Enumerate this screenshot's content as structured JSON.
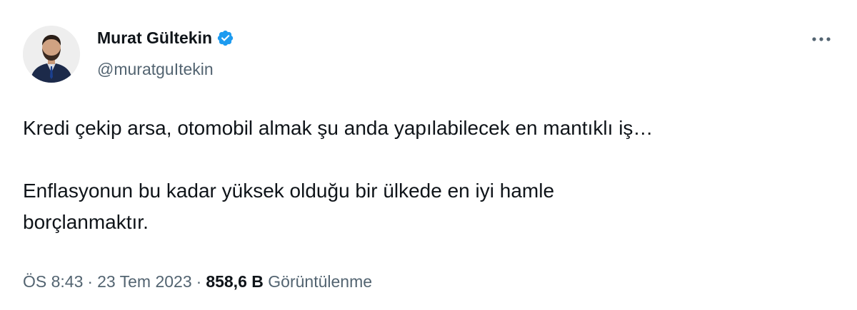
{
  "author": {
    "display_name": "Murat Gültekin",
    "handle": "@muratguItekin",
    "verified": true
  },
  "icons": {
    "verified": "verified-badge-icon",
    "more": "more-horizontal-icon",
    "avatar": "profile-avatar"
  },
  "colors": {
    "verified_blue": "#1d9bf0",
    "text_primary": "#0f1419",
    "text_secondary": "#536471"
  },
  "tweet": {
    "paragraphs": [
      "Kredi çekip arsa, otomobil almak şu anda yapılabilecek en mantıklı iş…",
      "Enflasyonun bu kadar yüksek olduğu bir ülkede en iyi hamle",
      "borçlanmaktır."
    ]
  },
  "meta": {
    "time": "ÖS 8:43",
    "separator": "·",
    "date": "23 Tem 2023",
    "views_count": "858,6 B",
    "views_label": "Görüntülenme"
  }
}
